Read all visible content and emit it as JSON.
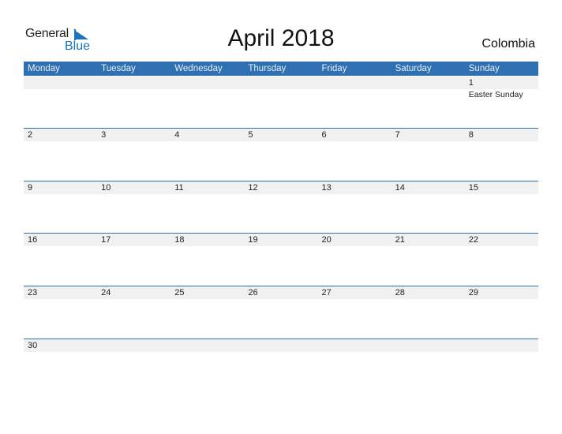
{
  "logo": {
    "general": "General",
    "blue": "Blue"
  },
  "title": "April 2018",
  "country": "Colombia",
  "colors": {
    "header": "#2e70b1",
    "band": "#f1f1f1",
    "logo_blue": "#1c75bc"
  },
  "weekdays": [
    "Monday",
    "Tuesday",
    "Wednesday",
    "Thursday",
    "Friday",
    "Saturday",
    "Sunday"
  ],
  "weeks": [
    [
      {
        "day": ""
      },
      {
        "day": ""
      },
      {
        "day": ""
      },
      {
        "day": ""
      },
      {
        "day": ""
      },
      {
        "day": ""
      },
      {
        "day": "1",
        "holiday": "Easter Sunday"
      }
    ],
    [
      {
        "day": "2"
      },
      {
        "day": "3"
      },
      {
        "day": "4"
      },
      {
        "day": "5"
      },
      {
        "day": "6"
      },
      {
        "day": "7"
      },
      {
        "day": "8"
      }
    ],
    [
      {
        "day": "9"
      },
      {
        "day": "10"
      },
      {
        "day": "11"
      },
      {
        "day": "12"
      },
      {
        "day": "13"
      },
      {
        "day": "14"
      },
      {
        "day": "15"
      }
    ],
    [
      {
        "day": "16"
      },
      {
        "day": "17"
      },
      {
        "day": "18"
      },
      {
        "day": "19"
      },
      {
        "day": "20"
      },
      {
        "day": "21"
      },
      {
        "day": "22"
      }
    ],
    [
      {
        "day": "23"
      },
      {
        "day": "24"
      },
      {
        "day": "25"
      },
      {
        "day": "26"
      },
      {
        "day": "27"
      },
      {
        "day": "28"
      },
      {
        "day": "29"
      }
    ],
    [
      {
        "day": "30"
      },
      {
        "day": ""
      },
      {
        "day": ""
      },
      {
        "day": ""
      },
      {
        "day": ""
      },
      {
        "day": ""
      },
      {
        "day": ""
      }
    ]
  ]
}
